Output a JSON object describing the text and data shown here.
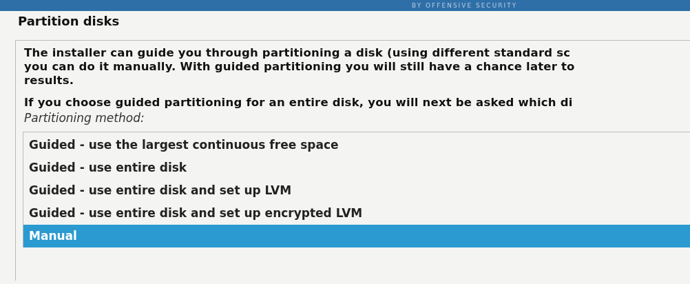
{
  "banner": {
    "text": "BY OFFENSIVE SECURITY"
  },
  "title": "Partition disks",
  "description_lines": [
    "The installer can guide you through partitioning a disk (using different standard sc",
    "you can do it manually. With guided partitioning you will still have a chance later to",
    "results."
  ],
  "note": "If you choose guided partitioning for an entire disk, you will next be asked which di",
  "list_label": "Partitioning method:",
  "options": [
    {
      "label": "Guided - use the largest continuous free space",
      "selected": false
    },
    {
      "label": "Guided - use entire disk",
      "selected": false
    },
    {
      "label": "Guided - use entire disk and set up LVM",
      "selected": false
    },
    {
      "label": "Guided - use entire disk and set up encrypted LVM",
      "selected": false
    },
    {
      "label": "Manual",
      "selected": true
    }
  ]
}
